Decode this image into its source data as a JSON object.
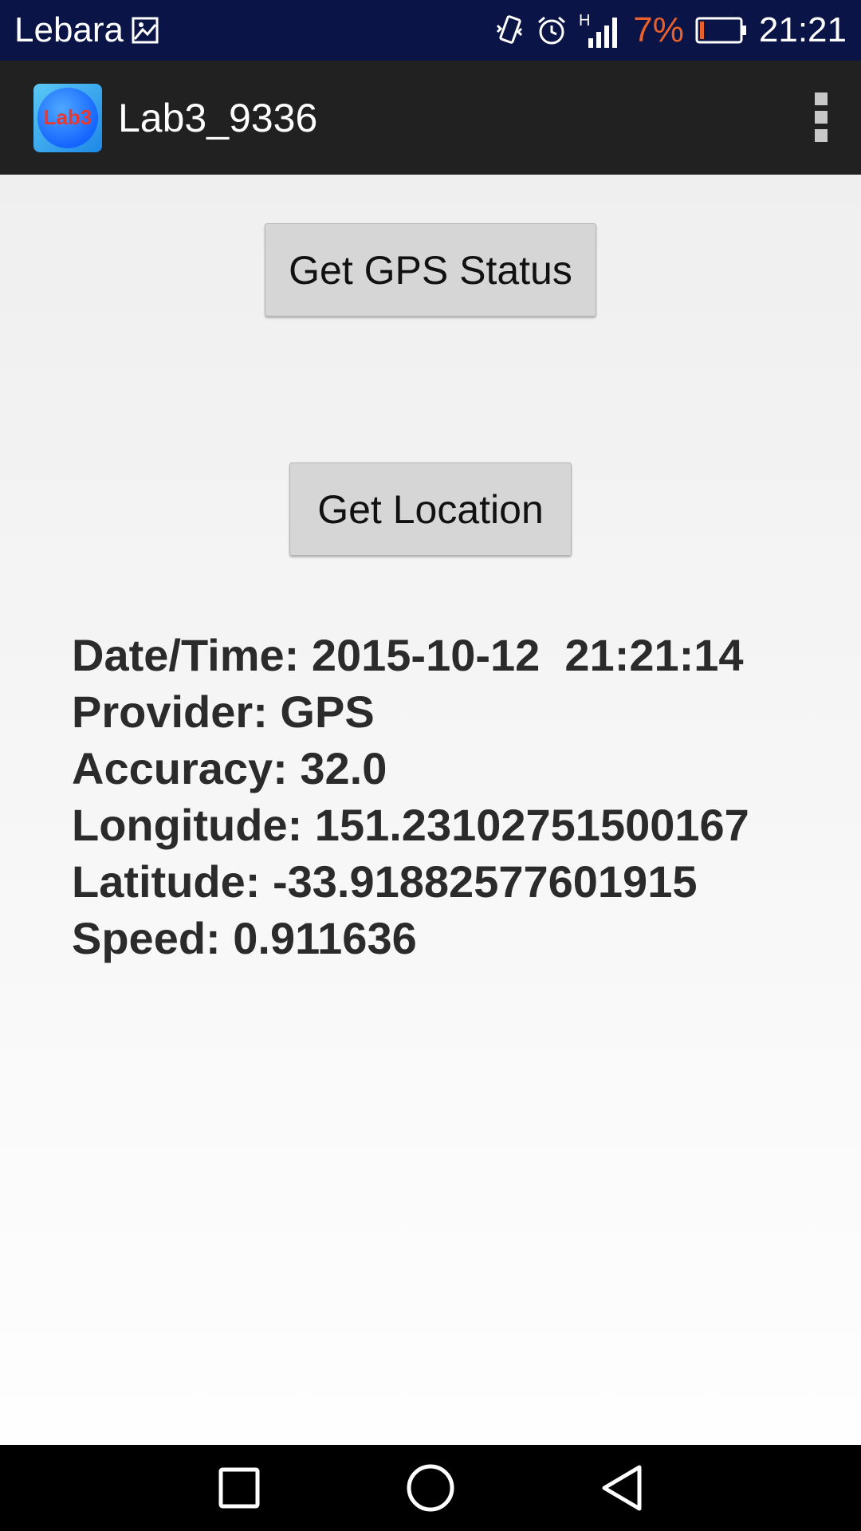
{
  "status_bar": {
    "carrier": "Lebara",
    "battery_percent": "7%",
    "time": "21:21",
    "network_type": "H",
    "icons": [
      "image-icon",
      "vibrate-icon",
      "alarm-icon",
      "signal-icon",
      "battery-icon"
    ]
  },
  "app_bar": {
    "logo_text": "Lab3",
    "title": "Lab3_9336"
  },
  "buttons": {
    "gps_status": "Get GPS Status",
    "get_location": "Get Location"
  },
  "location_info": {
    "datetime": "Date/Time: 2015-10-12  21:21:14",
    "provider": "Provider: GPS",
    "accuracy": "Accuracy: 32.0",
    "longitude": "Longitude: 151.23102751500167",
    "latitude": "Latitude: -33.91882577601915",
    "speed": "Speed: 0.911636"
  },
  "colors": {
    "status_bar_bg": "#0a1446",
    "action_bar_bg": "#212121",
    "battery_low": "#e8612c",
    "button_bg": "#d6d6d6"
  }
}
